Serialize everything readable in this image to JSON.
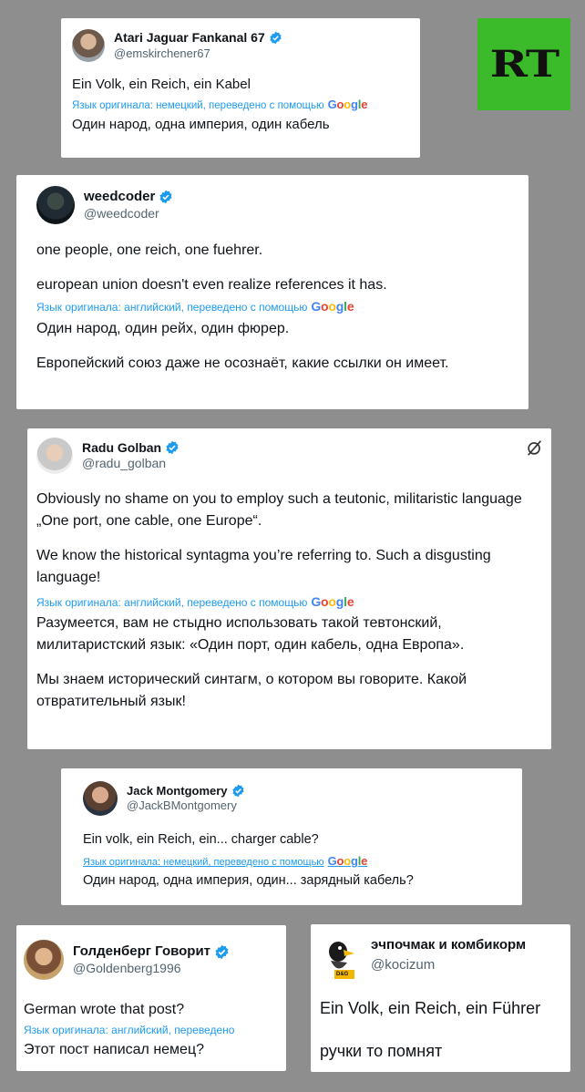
{
  "colors": {
    "background": "#8e8e8e",
    "card": "#ffffff",
    "link_blue": "#1d9bf0",
    "verified_blue": "#1d9bf0",
    "rt_green": "#3cbb2a"
  },
  "rt_logo": {
    "text": "RT"
  },
  "posts": [
    {
      "name": "Atari Jaguar Fankanal 67",
      "handle": "@emskirchener67",
      "text": "Ein Volk, ein Reich, ein Kabel",
      "translate_label": "Язык оригинала: немецкий, переведено с помощью",
      "translate_brand": "Google",
      "translation": "Один народ, одна империя, один кабель"
    },
    {
      "name": "weedcoder",
      "handle": "@weedcoder",
      "text_lines": [
        "one people, one reich, one fuehrer.",
        "european union doesn't even realize references it has."
      ],
      "translate_label": "Язык оригинала: английский, переведено с помощью",
      "translate_brand": "Google",
      "translation_lines": [
        "Один народ, один рейх, один фюрер.",
        "Европейский союз даже не осознаёт, какие ссылки он имеет."
      ]
    },
    {
      "name": "Radu Golban",
      "handle": "@radu_golban",
      "grok_icon": "grok-icon",
      "text_lines": [
        "Obviously no shame on you to employ such a teutonic, militaristic language „One port, one cable, one Europe“.",
        "We know the historical syntagma you’re referring to. Such a disgusting language!"
      ],
      "translate_label": "Язык оригинала: английский, переведено с помощью",
      "translate_brand": "Google",
      "translation_lines": [
        "Разумеется, вам не стыдно использовать такой тевтонский, милитаристский язык: «Один порт, один кабель, одна Европа».",
        "Мы знаем исторический синтагм, о котором вы говорите. Какой отвратительный язык!"
      ]
    },
    {
      "name": "Jack Montgomery",
      "handle": "@JackBMontgomery",
      "text": "Ein volk, ein Reich, ein... charger cable?",
      "translate_label": "Язык оригинала: немецкий, переведено с помощью",
      "translate_brand": "Google",
      "translation": "Один народ, одна империя, один... зарядный кабель?"
    },
    {
      "name": "Голденберг Говорит",
      "handle": "@Goldenberg1996",
      "text": "German wrote that post?",
      "translate_label": "Язык оригинала: английский, переведено",
      "translation": "Этот пост написал немец?"
    },
    {
      "name": "эчпочмак и комбикорм",
      "handle": "@kocizum",
      "avatar_badge": "D&G",
      "text": "Ein Volk, ein Reich, ein Führer",
      "text2": "ручки то помнят"
    }
  ]
}
